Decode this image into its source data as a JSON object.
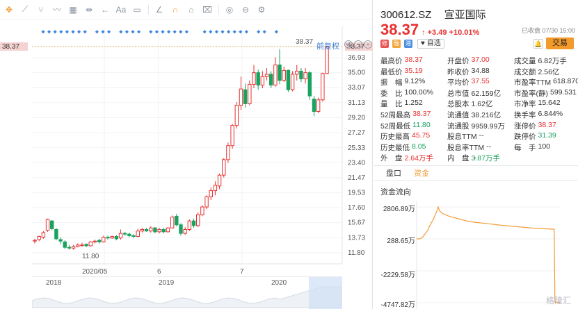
{
  "toolbar": {
    "icons": [
      "move-icon",
      "line-icon",
      "fork-icon",
      "wave-icon",
      "calendar-icon",
      "range-icon",
      "arrow-left-right-icon",
      "text-icon",
      "comment-icon",
      "ruler-icon",
      "magnet-icon",
      "lock-icon",
      "trash-icon",
      "eye-icon",
      "layers-icon",
      "settings-icon"
    ]
  },
  "chart": {
    "fuquan_label": "前复权",
    "max_price_label": "38.37",
    "min_price_label": "11.80",
    "current_price_tag": "38.37",
    "left_price_tag": "38.37",
    "y_ticks": [
      "38.37",
      "36.93",
      "35.00",
      "33.07",
      "31.13",
      "29.20",
      "27.27",
      "25.33",
      "23.40",
      "21.47",
      "19.53",
      "17.60",
      "15.67",
      "13.73",
      "11.80"
    ],
    "y_tick_values": [
      38.37,
      36.93,
      35.0,
      33.07,
      31.13,
      29.2,
      27.27,
      25.33,
      23.4,
      21.47,
      19.53,
      17.6,
      15.67,
      13.73,
      11.8
    ],
    "x_labels": [
      "2020/05",
      "6",
      "7"
    ],
    "nav_years": [
      "2018",
      "2019",
      "2020"
    ],
    "ctrl_labels": [
      "↺",
      "−",
      "+"
    ],
    "candles": [
      [
        13.3,
        13.4,
        13.0,
        13.6
      ],
      [
        13.5,
        13.9,
        13.3,
        14.0
      ],
      [
        13.8,
        14.4,
        13.6,
        14.6
      ],
      [
        14.7,
        16.1,
        14.5,
        16.2
      ],
      [
        15.9,
        14.9,
        14.7,
        16.0
      ],
      [
        14.8,
        13.6,
        13.4,
        15.0
      ],
      [
        13.5,
        13.3,
        12.9,
        13.8
      ],
      [
        13.2,
        12.5,
        12.3,
        13.4
      ],
      [
        12.5,
        12.4,
        12.2,
        12.8
      ],
      [
        12.4,
        12.6,
        12.2,
        12.8
      ],
      [
        12.6,
        12.8,
        12.5,
        13.0
      ],
      [
        12.8,
        12.8,
        12.6,
        13.1
      ],
      [
        12.9,
        12.7,
        12.5,
        13.0
      ],
      [
        12.7,
        13.2,
        12.6,
        13.3
      ],
      [
        13.2,
        13.3,
        13.0,
        13.5
      ],
      [
        13.4,
        13.2,
        13.0,
        13.6
      ],
      [
        13.2,
        13.8,
        13.1,
        14.0
      ],
      [
        13.8,
        13.7,
        13.5,
        14.0
      ],
      [
        13.7,
        13.9,
        13.6,
        14.0
      ],
      [
        13.9,
        13.6,
        13.4,
        14.1
      ],
      [
        13.7,
        14.3,
        13.5,
        14.8
      ],
      [
        14.3,
        14.2,
        14.0,
        14.5
      ],
      [
        14.2,
        14.0,
        13.8,
        14.4
      ],
      [
        14.0,
        13.9,
        13.7,
        14.2
      ],
      [
        13.9,
        14.6,
        13.8,
        14.9
      ],
      [
        14.6,
        14.8,
        14.4,
        15.0
      ],
      [
        14.8,
        14.6,
        14.5,
        15.0
      ],
      [
        14.6,
        15.0,
        14.4,
        15.2
      ],
      [
        15.0,
        14.5,
        14.3,
        15.1
      ],
      [
        14.5,
        14.8,
        14.3,
        15.0
      ],
      [
        14.8,
        14.5,
        14.3,
        15.0
      ],
      [
        14.5,
        15.0,
        14.4,
        15.1
      ],
      [
        15.0,
        16.4,
        14.9,
        16.6
      ],
      [
        16.5,
        15.4,
        15.2,
        16.8
      ],
      [
        15.4,
        14.3,
        14.0,
        15.6
      ],
      [
        14.3,
        14.8,
        14.1,
        15.1
      ],
      [
        14.8,
        15.9,
        14.6,
        16.1
      ],
      [
        15.9,
        15.3,
        15.0,
        16.2
      ],
      [
        15.3,
        16.7,
        15.1,
        17.0
      ],
      [
        16.7,
        17.7,
        16.5,
        17.9
      ],
      [
        17.7,
        19.0,
        17.4,
        19.2
      ],
      [
        19.0,
        19.8,
        18.6,
        20.2
      ],
      [
        19.8,
        20.5,
        19.2,
        21.0
      ],
      [
        20.4,
        21.8,
        20.0,
        22.0
      ],
      [
        21.8,
        23.8,
        21.5,
        24.0
      ],
      [
        23.8,
        25.6,
        23.4,
        26.0
      ],
      [
        25.6,
        28.2,
        25.2,
        28.4
      ],
      [
        28.2,
        30.8,
        27.8,
        31.2
      ],
      [
        30.8,
        32.9,
        30.2,
        34.5
      ],
      [
        32.8,
        31.0,
        30.5,
        33.6
      ],
      [
        31.0,
        33.5,
        30.8,
        34.0
      ],
      [
        33.5,
        35.0,
        33.0,
        36.0
      ],
      [
        35.0,
        33.4,
        32.8,
        35.4
      ],
      [
        33.4,
        34.5,
        33.0,
        35.2
      ],
      [
        34.5,
        34.8,
        34.0,
        35.6
      ],
      [
        34.8,
        33.4,
        33.0,
        35.2
      ],
      [
        33.4,
        36.0,
        33.2,
        37.0
      ],
      [
        36.0,
        34.0,
        33.5,
        38.0
      ],
      [
        34.0,
        35.3,
        33.8,
        35.8
      ],
      [
        35.3,
        32.8,
        32.5,
        35.4
      ],
      [
        32.8,
        34.8,
        32.6,
        35.2
      ],
      [
        34.8,
        35.2,
        34.0,
        36.0
      ],
      [
        35.2,
        34.2,
        33.8,
        35.6
      ],
      [
        34.2,
        35.0,
        33.6,
        35.6
      ],
      [
        35.0,
        32.0,
        31.5,
        35.2
      ],
      [
        31.6,
        30.0,
        29.4,
        32.0
      ],
      [
        30.0,
        31.5,
        29.8,
        31.8
      ],
      [
        31.5,
        34.9,
        31.3,
        35.0
      ],
      [
        34.9,
        38.37,
        34.8,
        38.37
      ]
    ]
  },
  "quote": {
    "code": "300612.SZ",
    "name": "宣亚国际",
    "price": "38.37",
    "change": "+3.49",
    "change_pct": "+10.01%",
    "closed": "已收盘 07/30 15:00",
    "fav_label": "自选",
    "trade_label": "交易",
    "badges": [
      {
        "name": "xiu-badge",
        "text": "修",
        "color": "#e95353"
      },
      {
        "name": "rong-badge",
        "text": "融",
        "color": "#f3a53a"
      },
      {
        "name": "gang-badge",
        "text": "港",
        "color": "#4a90e2"
      }
    ],
    "stats": [
      [
        [
          "最高价",
          "38.37",
          "red"
        ],
        [
          "开盘价",
          "37.00",
          "red"
        ],
        [
          "成交量",
          "6.82万手",
          ""
        ]
      ],
      [
        [
          "最低价",
          "35.19",
          "red"
        ],
        [
          "昨收价",
          "34.88",
          ""
        ],
        [
          "成交额",
          "2.56亿",
          ""
        ]
      ],
      [
        [
          "振　幅",
          "9.12%",
          ""
        ],
        [
          "平均价",
          "37.55",
          "red"
        ],
        [
          "市盈率TTM",
          "618.870",
          ""
        ]
      ],
      [
        [
          "委　比",
          "100.00%",
          ""
        ],
        [
          "总市值",
          "62.159亿",
          ""
        ],
        [
          "市盈率(静)",
          "599.531",
          ""
        ]
      ],
      [
        [
          "量　比",
          "1.252",
          ""
        ],
        [
          "总股本",
          "1.62亿",
          ""
        ],
        [
          "市净率",
          "15.642",
          ""
        ]
      ],
      [
        [
          "52周最高",
          "38.37",
          "red"
        ],
        [
          "流通值",
          "38.216亿",
          ""
        ],
        [
          "换手率",
          "6.844%",
          ""
        ]
      ],
      [
        [
          "52周最低",
          "11.80",
          "green"
        ],
        [
          "流通股",
          "9959.99万",
          ""
        ],
        [
          "涨停价",
          "38.37",
          "red"
        ]
      ],
      [
        [
          "历史最高",
          "45.75",
          "red"
        ],
        [
          "股息TTM",
          "--",
          ""
        ],
        [
          "跌停价",
          "31.39",
          "green"
        ]
      ],
      [
        [
          "历史最低",
          "8.05",
          "green"
        ],
        [
          "股息率TTM",
          "--",
          ""
        ],
        [
          "每　手",
          "100",
          ""
        ]
      ],
      [
        [
          "外　盘",
          "2.64万手",
          "red"
        ],
        [
          "内　盘",
          "3.87万手",
          "green"
        ],
        [
          "",
          "",
          ""
        ]
      ]
    ],
    "tabs": [
      "盘口",
      "资金"
    ],
    "active_tab": 1,
    "flow_title": "资金流向",
    "flow_labels": [
      "2806.89万",
      "288.65万",
      "-2229.58万",
      "-4747.82万"
    ],
    "flow_label_values": [
      2806.89,
      288.65,
      -2229.58,
      -4747.82
    ],
    "flow_series": [
      [
        0,
        288.65
      ],
      [
        0.02,
        290
      ],
      [
        0.04,
        400
      ],
      [
        0.06,
        700
      ],
      [
        0.08,
        1000
      ],
      [
        0.09,
        1300
      ],
      [
        0.1,
        1500
      ],
      [
        0.11,
        1700
      ],
      [
        0.12,
        1900
      ],
      [
        0.13,
        2200
      ],
      [
        0.14,
        2450
      ],
      [
        0.15,
        2806.89
      ],
      [
        0.16,
        2500
      ],
      [
        0.18,
        2300
      ],
      [
        0.2,
        2200
      ],
      [
        0.22,
        2100
      ],
      [
        0.25,
        2000
      ],
      [
        0.3,
        1850
      ],
      [
        0.35,
        1700
      ],
      [
        0.4,
        1600
      ],
      [
        0.5,
        1480
      ],
      [
        0.6,
        1350
      ],
      [
        0.7,
        1250
      ],
      [
        0.8,
        1150
      ],
      [
        0.9,
        1080
      ],
      [
        0.96,
        1050
      ],
      [
        0.965,
        -4700
      ],
      [
        1.0,
        -4747.82
      ]
    ],
    "watermark": "格隆汇"
  }
}
